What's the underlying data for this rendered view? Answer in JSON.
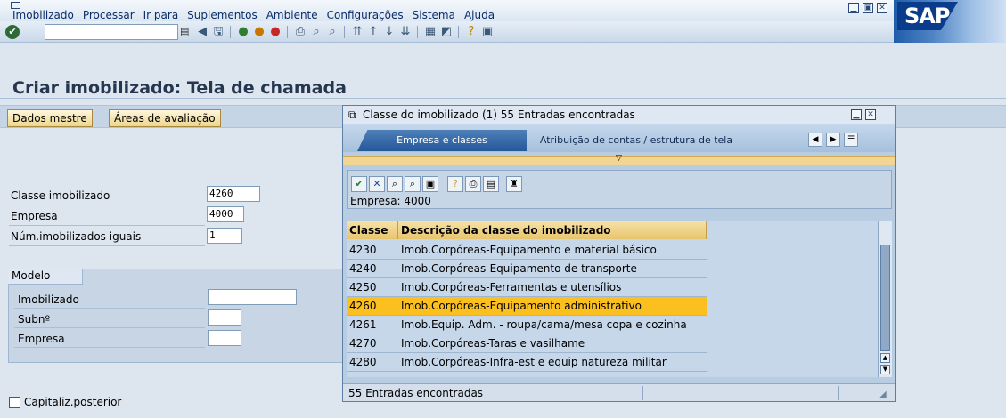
{
  "menu": {
    "items": [
      "Imobilizado",
      "Processar",
      "Ir para",
      "Suplementos",
      "Ambiente",
      "Configurações",
      "Sistema",
      "Ajuda"
    ]
  },
  "logo": "SAP",
  "toolbar": {
    "command_value": ""
  },
  "page": {
    "title": "Criar imobilizado: Tela de chamada"
  },
  "app_toolbar": {
    "buttons": [
      "Dados mestre",
      "Áreas de avaliação"
    ]
  },
  "form": {
    "fields": [
      {
        "label": "Classe imobilizado",
        "value": "4260"
      },
      {
        "label": "Empresa",
        "value": "4000"
      },
      {
        "label": "Núm.imobilizados iguais",
        "value": "1"
      }
    ],
    "modelo": {
      "title": "Modelo",
      "fields": [
        {
          "label": "Imobilizado",
          "value": ""
        },
        {
          "label": "Subnº",
          "value": ""
        },
        {
          "label": "Empresa",
          "value": ""
        }
      ]
    },
    "checkbox": {
      "label": "Capitaliz.posterior",
      "checked": false
    }
  },
  "popup": {
    "title": "Classe do imobilizado (1)  55 Entradas encontradas",
    "tabs": [
      "Empresa e classes",
      "Atribuição de contas / estrutura de tela"
    ],
    "empresa_line": "Empresa: 4000",
    "table": {
      "headers": [
        "Classe",
        "Descrição da classe do imobilizado"
      ],
      "rows": [
        {
          "classe": "4230",
          "descricao": "Imob.Corpóreas-Equipamento e material básico"
        },
        {
          "classe": "4240",
          "descricao": "Imob.Corpóreas-Equipamento de transporte"
        },
        {
          "classe": "4250",
          "descricao": "Imob.Corpóreas-Ferramentas e utensílios"
        },
        {
          "classe": "4260",
          "descricao": "Imob.Corpóreas-Equipamento administrativo"
        },
        {
          "classe": "4261",
          "descricao": "Imob.Equip. Adm. - roupa/cama/mesa copa e cozinha"
        },
        {
          "classe": "4270",
          "descricao": "Imob.Corpóreas-Taras e vasilhame"
        },
        {
          "classe": "4280",
          "descricao": "Imob.Corpóreas-Infra-est e equip natureza militar"
        }
      ],
      "selected_classe": "4260"
    },
    "status": "55 Entradas encontradas"
  },
  "colors": {
    "selected_row": "#fbc01f",
    "header_gold": "#e8c56d",
    "active_tab": "#26589a",
    "background": "#dde5ee"
  },
  "icons": {
    "toolbar": [
      "enter-icon",
      "save-icon",
      "back-icon",
      "exit-icon",
      "cancel-icon",
      "print-icon",
      "find-icon",
      "find-next-icon",
      "first-page-icon",
      "previous-page-icon",
      "next-page-icon",
      "last-page-icon",
      "create-session-icon",
      "shortcut-icon",
      "help-icon",
      "layout-icon"
    ]
  }
}
